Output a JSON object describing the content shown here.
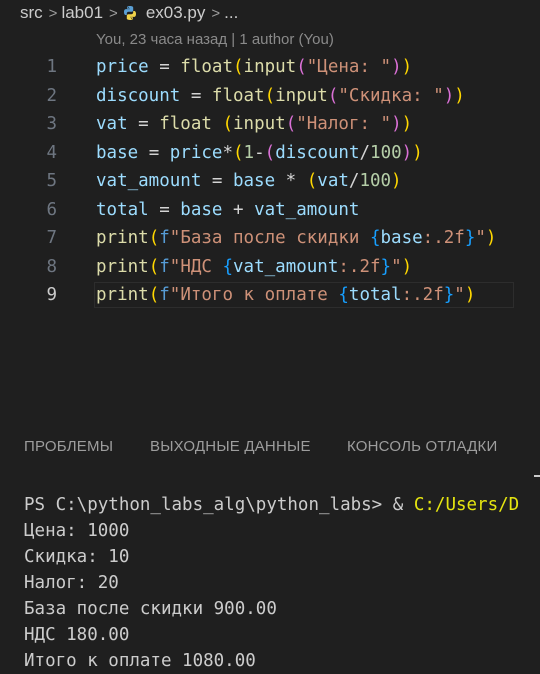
{
  "breadcrumb": {
    "folder1": "src",
    "folder2": "lab01",
    "file": "ex03.py",
    "trail": "..."
  },
  "blame": "You, 23 часа назад | 1 author (You)",
  "editor": {
    "line_numbers": [
      "1",
      "2",
      "3",
      "4",
      "5",
      "6",
      "7",
      "8",
      "9"
    ],
    "active_line": 9
  },
  "panel": {
    "tabs": [
      "ПРОБЛЕМЫ",
      "ВЫХОДНЫЕ ДАННЫЕ",
      "КОНСОЛЬ ОТЛАДКИ"
    ]
  },
  "terminal": {
    "prompt": "PS C:\\python_labs_alg\\python_labs> ",
    "amp": "& ",
    "command": "C:/Users/D",
    "lines": [
      "Цена: 1000",
      "Скидка: 10",
      "Налог: 20",
      "База после скидки 900.00",
      "НДС 180.00",
      "Итого к оплате 1080.00"
    ]
  },
  "colors": {
    "background": "#1f1f1f",
    "string": "#ce9178",
    "variable": "#9cdcfe",
    "function": "#dcdcaa"
  }
}
